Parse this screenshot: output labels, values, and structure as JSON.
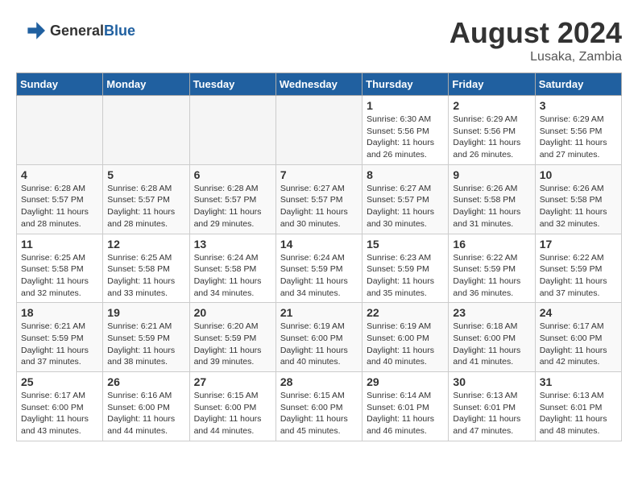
{
  "header": {
    "logo_general": "General",
    "logo_blue": "Blue",
    "month_year": "August 2024",
    "location": "Lusaka, Zambia"
  },
  "days_of_week": [
    "Sunday",
    "Monday",
    "Tuesday",
    "Wednesday",
    "Thursday",
    "Friday",
    "Saturday"
  ],
  "weeks": [
    {
      "days": [
        {
          "num": "",
          "empty": true
        },
        {
          "num": "",
          "empty": true
        },
        {
          "num": "",
          "empty": true
        },
        {
          "num": "",
          "empty": true
        },
        {
          "num": "1",
          "sunrise": "6:30 AM",
          "sunset": "5:56 PM",
          "daylight": "11 hours and 26 minutes."
        },
        {
          "num": "2",
          "sunrise": "6:29 AM",
          "sunset": "5:56 PM",
          "daylight": "11 hours and 26 minutes."
        },
        {
          "num": "3",
          "sunrise": "6:29 AM",
          "sunset": "5:56 PM",
          "daylight": "11 hours and 27 minutes."
        }
      ]
    },
    {
      "days": [
        {
          "num": "4",
          "sunrise": "6:28 AM",
          "sunset": "5:57 PM",
          "daylight": "11 hours and 28 minutes."
        },
        {
          "num": "5",
          "sunrise": "6:28 AM",
          "sunset": "5:57 PM",
          "daylight": "11 hours and 28 minutes."
        },
        {
          "num": "6",
          "sunrise": "6:28 AM",
          "sunset": "5:57 PM",
          "daylight": "11 hours and 29 minutes."
        },
        {
          "num": "7",
          "sunrise": "6:27 AM",
          "sunset": "5:57 PM",
          "daylight": "11 hours and 30 minutes."
        },
        {
          "num": "8",
          "sunrise": "6:27 AM",
          "sunset": "5:57 PM",
          "daylight": "11 hours and 30 minutes."
        },
        {
          "num": "9",
          "sunrise": "6:26 AM",
          "sunset": "5:58 PM",
          "daylight": "11 hours and 31 minutes."
        },
        {
          "num": "10",
          "sunrise": "6:26 AM",
          "sunset": "5:58 PM",
          "daylight": "11 hours and 32 minutes."
        }
      ]
    },
    {
      "days": [
        {
          "num": "11",
          "sunrise": "6:25 AM",
          "sunset": "5:58 PM",
          "daylight": "11 hours and 32 minutes."
        },
        {
          "num": "12",
          "sunrise": "6:25 AM",
          "sunset": "5:58 PM",
          "daylight": "11 hours and 33 minutes."
        },
        {
          "num": "13",
          "sunrise": "6:24 AM",
          "sunset": "5:58 PM",
          "daylight": "11 hours and 34 minutes."
        },
        {
          "num": "14",
          "sunrise": "6:24 AM",
          "sunset": "5:59 PM",
          "daylight": "11 hours and 34 minutes."
        },
        {
          "num": "15",
          "sunrise": "6:23 AM",
          "sunset": "5:59 PM",
          "daylight": "11 hours and 35 minutes."
        },
        {
          "num": "16",
          "sunrise": "6:22 AM",
          "sunset": "5:59 PM",
          "daylight": "11 hours and 36 minutes."
        },
        {
          "num": "17",
          "sunrise": "6:22 AM",
          "sunset": "5:59 PM",
          "daylight": "11 hours and 37 minutes."
        }
      ]
    },
    {
      "days": [
        {
          "num": "18",
          "sunrise": "6:21 AM",
          "sunset": "5:59 PM",
          "daylight": "11 hours and 37 minutes."
        },
        {
          "num": "19",
          "sunrise": "6:21 AM",
          "sunset": "5:59 PM",
          "daylight": "11 hours and 38 minutes."
        },
        {
          "num": "20",
          "sunrise": "6:20 AM",
          "sunset": "5:59 PM",
          "daylight": "11 hours and 39 minutes."
        },
        {
          "num": "21",
          "sunrise": "6:19 AM",
          "sunset": "6:00 PM",
          "daylight": "11 hours and 40 minutes."
        },
        {
          "num": "22",
          "sunrise": "6:19 AM",
          "sunset": "6:00 PM",
          "daylight": "11 hours and 40 minutes."
        },
        {
          "num": "23",
          "sunrise": "6:18 AM",
          "sunset": "6:00 PM",
          "daylight": "11 hours and 41 minutes."
        },
        {
          "num": "24",
          "sunrise": "6:17 AM",
          "sunset": "6:00 PM",
          "daylight": "11 hours and 42 minutes."
        }
      ]
    },
    {
      "days": [
        {
          "num": "25",
          "sunrise": "6:17 AM",
          "sunset": "6:00 PM",
          "daylight": "11 hours and 43 minutes."
        },
        {
          "num": "26",
          "sunrise": "6:16 AM",
          "sunset": "6:00 PM",
          "daylight": "11 hours and 44 minutes."
        },
        {
          "num": "27",
          "sunrise": "6:15 AM",
          "sunset": "6:00 PM",
          "daylight": "11 hours and 44 minutes."
        },
        {
          "num": "28",
          "sunrise": "6:15 AM",
          "sunset": "6:00 PM",
          "daylight": "11 hours and 45 minutes."
        },
        {
          "num": "29",
          "sunrise": "6:14 AM",
          "sunset": "6:01 PM",
          "daylight": "11 hours and 46 minutes."
        },
        {
          "num": "30",
          "sunrise": "6:13 AM",
          "sunset": "6:01 PM",
          "daylight": "11 hours and 47 minutes."
        },
        {
          "num": "31",
          "sunrise": "6:13 AM",
          "sunset": "6:01 PM",
          "daylight": "11 hours and 48 minutes."
        }
      ]
    }
  ]
}
